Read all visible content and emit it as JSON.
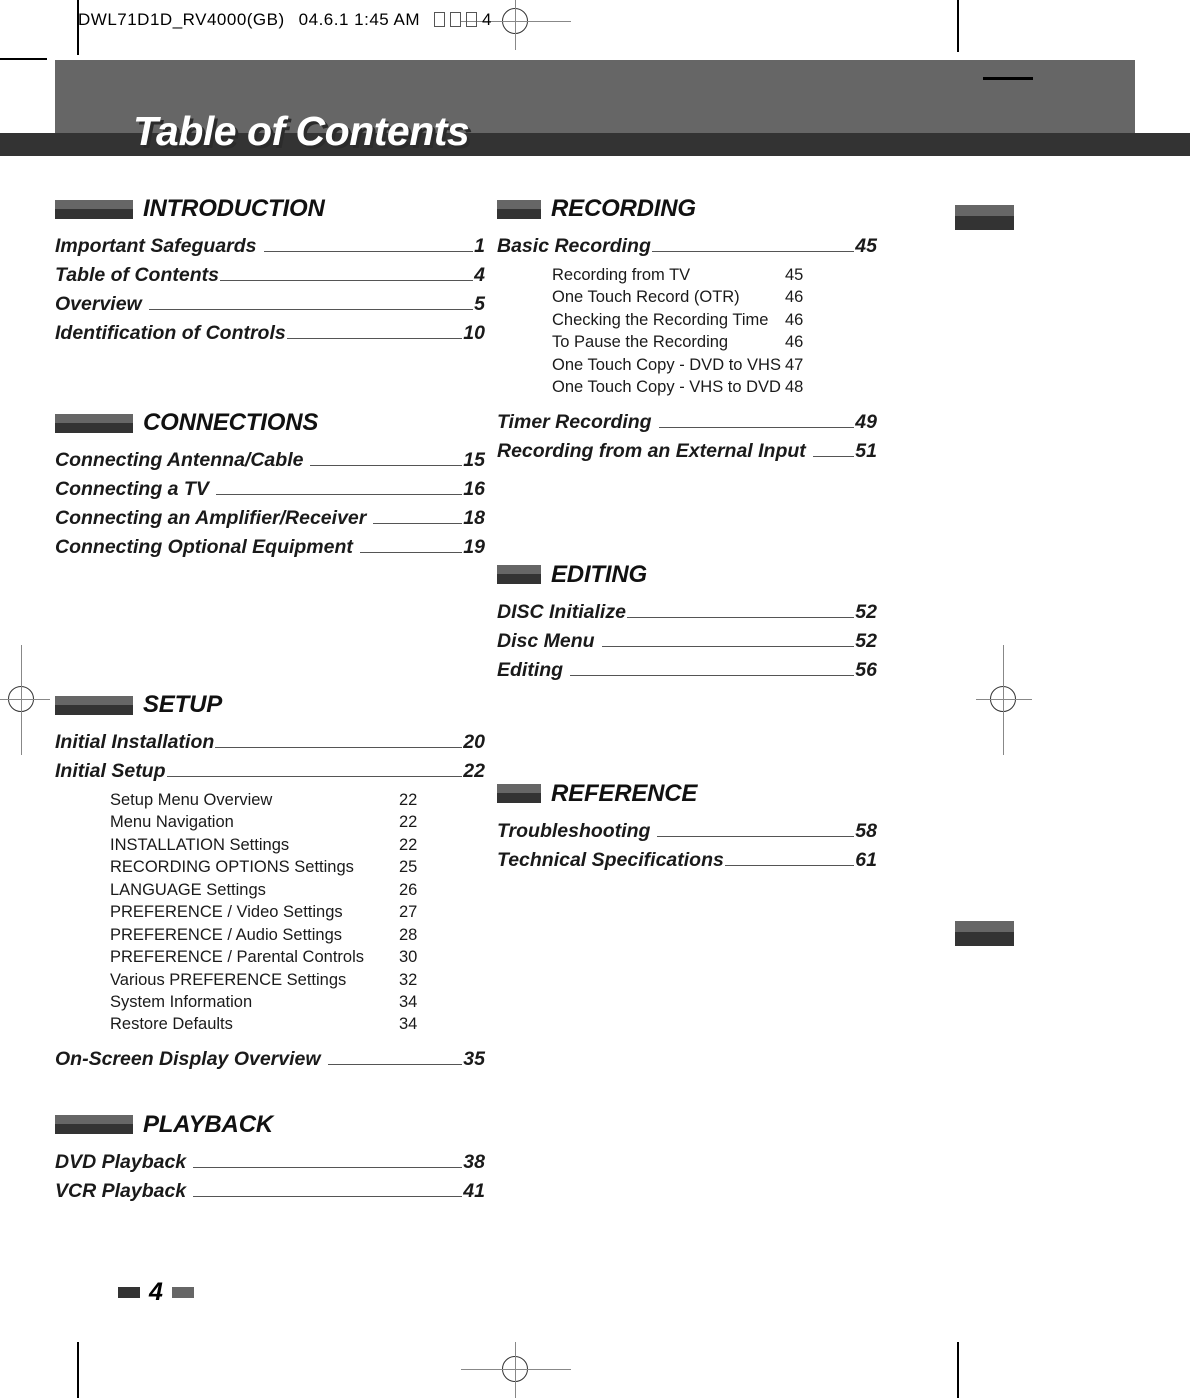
{
  "prepress": {
    "job_id": "DWL71D1D_RV4000(GB)",
    "date": "04.6.1",
    "time": "1:45 AM",
    "page_marker": "4"
  },
  "header": {
    "title": "Table of Contents"
  },
  "footer": {
    "page_number": "4"
  },
  "colors": {
    "banner_gray": "#666666",
    "banner_stripe": "#333333",
    "marker_light": "#666666",
    "marker_dark": "#333333"
  },
  "columns": {
    "left": [
      {
        "section": "INTRODUCTION",
        "entries": [
          {
            "label": "Important Safeguards",
            "page": "1"
          },
          {
            "label": "Table of Contents",
            "page": "4"
          },
          {
            "label": "Overview",
            "page": "5"
          },
          {
            "label": "Identification of Controls",
            "page": "10"
          }
        ]
      },
      {
        "section": "CONNECTIONS",
        "entries": [
          {
            "label": "Connecting Antenna/Cable",
            "page": "15"
          },
          {
            "label": "Connecting a TV",
            "page": "16"
          },
          {
            "label": "Connecting an Amplifier/Receiver",
            "page": "18"
          },
          {
            "label": "Connecting Optional Equipment",
            "page": "19"
          }
        ]
      },
      {
        "section": "SETUP",
        "entries": [
          {
            "label": "Initial Installation",
            "page": "20"
          },
          {
            "label": "Initial Setup",
            "page": "22"
          }
        ],
        "subentries": [
          {
            "label": "Setup Menu Overview",
            "page": "22"
          },
          {
            "label": "Menu Navigation",
            "page": "22"
          },
          {
            "label": "INSTALLATION Settings",
            "page": "22"
          },
          {
            "label": "RECORDING OPTIONS Settings",
            "page": "25"
          },
          {
            "label": "LANGUAGE Settings",
            "page": "26"
          },
          {
            "label": "PREFERENCE / Video Settings",
            "page": "27"
          },
          {
            "label": "PREFERENCE / Audio Settings",
            "page": "28"
          },
          {
            "label": "PREFERENCE / Parental Controls",
            "page": "30"
          },
          {
            "label": "Various PREFERENCE Settings",
            "page": "32"
          },
          {
            "label": "System Information",
            "page": "34"
          },
          {
            "label": "Restore Defaults",
            "page": "34"
          }
        ],
        "trailing_entries": [
          {
            "label": "On-Screen Display Overview",
            "page": "35"
          }
        ]
      },
      {
        "section": "PLAYBACK",
        "entries": [
          {
            "label": "DVD Playback",
            "page": "38"
          },
          {
            "label": "VCR Playback",
            "page": "41"
          }
        ]
      }
    ],
    "right": [
      {
        "section": "RECORDING",
        "entries": [
          {
            "label": "Basic Recording",
            "page": "45"
          }
        ],
        "subentries": [
          {
            "label": "Recording from TV",
            "page": "45"
          },
          {
            "label": "One Touch Record (OTR)",
            "page": "46"
          },
          {
            "label": "Checking the Recording Time",
            "page": "46"
          },
          {
            "label": "To Pause the Recording",
            "page": "46"
          },
          {
            "label": "One Touch Copy - DVD to VHS",
            "page": "47"
          },
          {
            "label": "One Touch Copy - VHS to DVD",
            "page": "48"
          }
        ],
        "trailing_entries": [
          {
            "label": "Timer Recording",
            "page": "49"
          },
          {
            "label": "Recording from an External Input",
            "page": "51"
          }
        ]
      },
      {
        "section": "EDITING",
        "entries": [
          {
            "label": "DISC Initialize",
            "page": "52"
          },
          {
            "label": "Disc Menu",
            "page": "52"
          },
          {
            "label": "Editing",
            "page": "56"
          }
        ]
      },
      {
        "section": "REFERENCE",
        "entries": [
          {
            "label": "Troubleshooting",
            "page": "58"
          },
          {
            "label": "Technical Specifications",
            "page": "61"
          }
        ]
      }
    ]
  }
}
